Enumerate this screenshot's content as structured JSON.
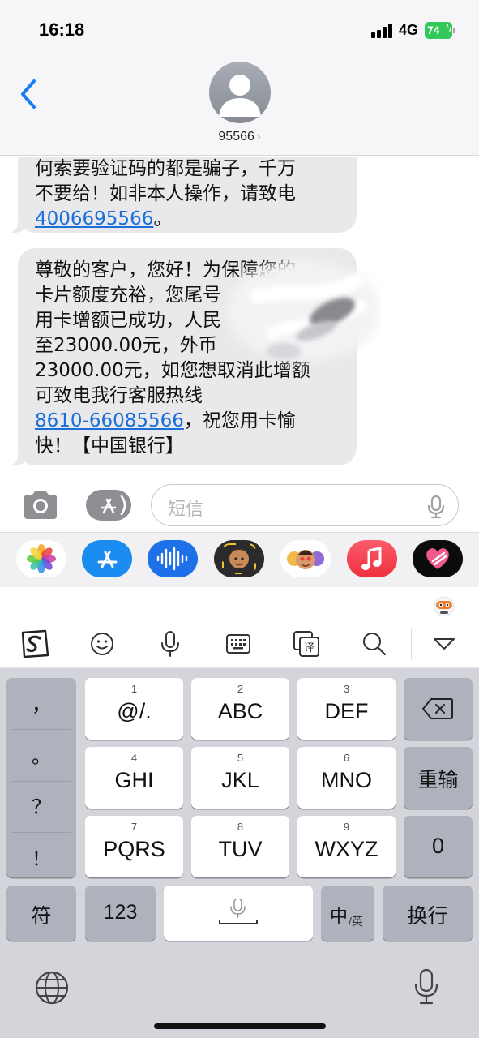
{
  "status_bar": {
    "time": "16:18",
    "network": "4G",
    "battery": "74"
  },
  "header": {
    "contact": "95566"
  },
  "messages": [
    {
      "lines": [
        {
          "text": "何索要验证码的都是骗子，千万"
        },
        {
          "text": "不要给！如非本人操作，请致电"
        },
        {
          "link": "4006695566",
          "after": "。"
        }
      ]
    },
    {
      "lines": [
        {
          "text": "尊敬的客户，您好！为保障您的"
        },
        {
          "text": "卡片额度充裕，您尾号"
        },
        {
          "text": "用卡增额已成功，人民"
        },
        {
          "text": "至23000.00元，外币"
        },
        {
          "text": "23000.00元，如您想取消此增额"
        },
        {
          "text": "可致电我行客服热线"
        },
        {
          "link": "8610-66085566",
          "after": "，祝您用卡愉"
        },
        {
          "text": "快！【中国银行】"
        }
      ]
    }
  ],
  "input": {
    "placeholder": "短信"
  },
  "app_drawer": [
    "photos-icon",
    "app-store-icon",
    "audio-message-icon",
    "memoji-icon",
    "animoji-stickers-icon",
    "music-icon",
    "heart-digital-touch-icon"
  ],
  "keyboard_toolbar": [
    "sogou-logo-icon",
    "emoji-icon",
    "voice-input-icon",
    "keyboard-layout-icon",
    "translate-icon",
    "search-icon",
    "collapse-keyboard-icon"
  ],
  "keyboard": {
    "punctuation": [
      "，",
      "。",
      "？",
      "！"
    ],
    "keys": [
      {
        "num": "1",
        "label": "@/."
      },
      {
        "num": "2",
        "label": "ABC"
      },
      {
        "num": "3",
        "label": "DEF"
      },
      {
        "num": "4",
        "label": "GHI"
      },
      {
        "num": "5",
        "label": "JKL"
      },
      {
        "num": "6",
        "label": "MNO"
      },
      {
        "num": "7",
        "label": "PQRS"
      },
      {
        "num": "8",
        "label": "TUV"
      },
      {
        "num": "9",
        "label": "WXYZ"
      }
    ],
    "retype": "重输",
    "zero": "0",
    "symbols": "符",
    "numbers": "123",
    "lang_main": "中",
    "lang_sub": "/英",
    "enter": "换行"
  }
}
